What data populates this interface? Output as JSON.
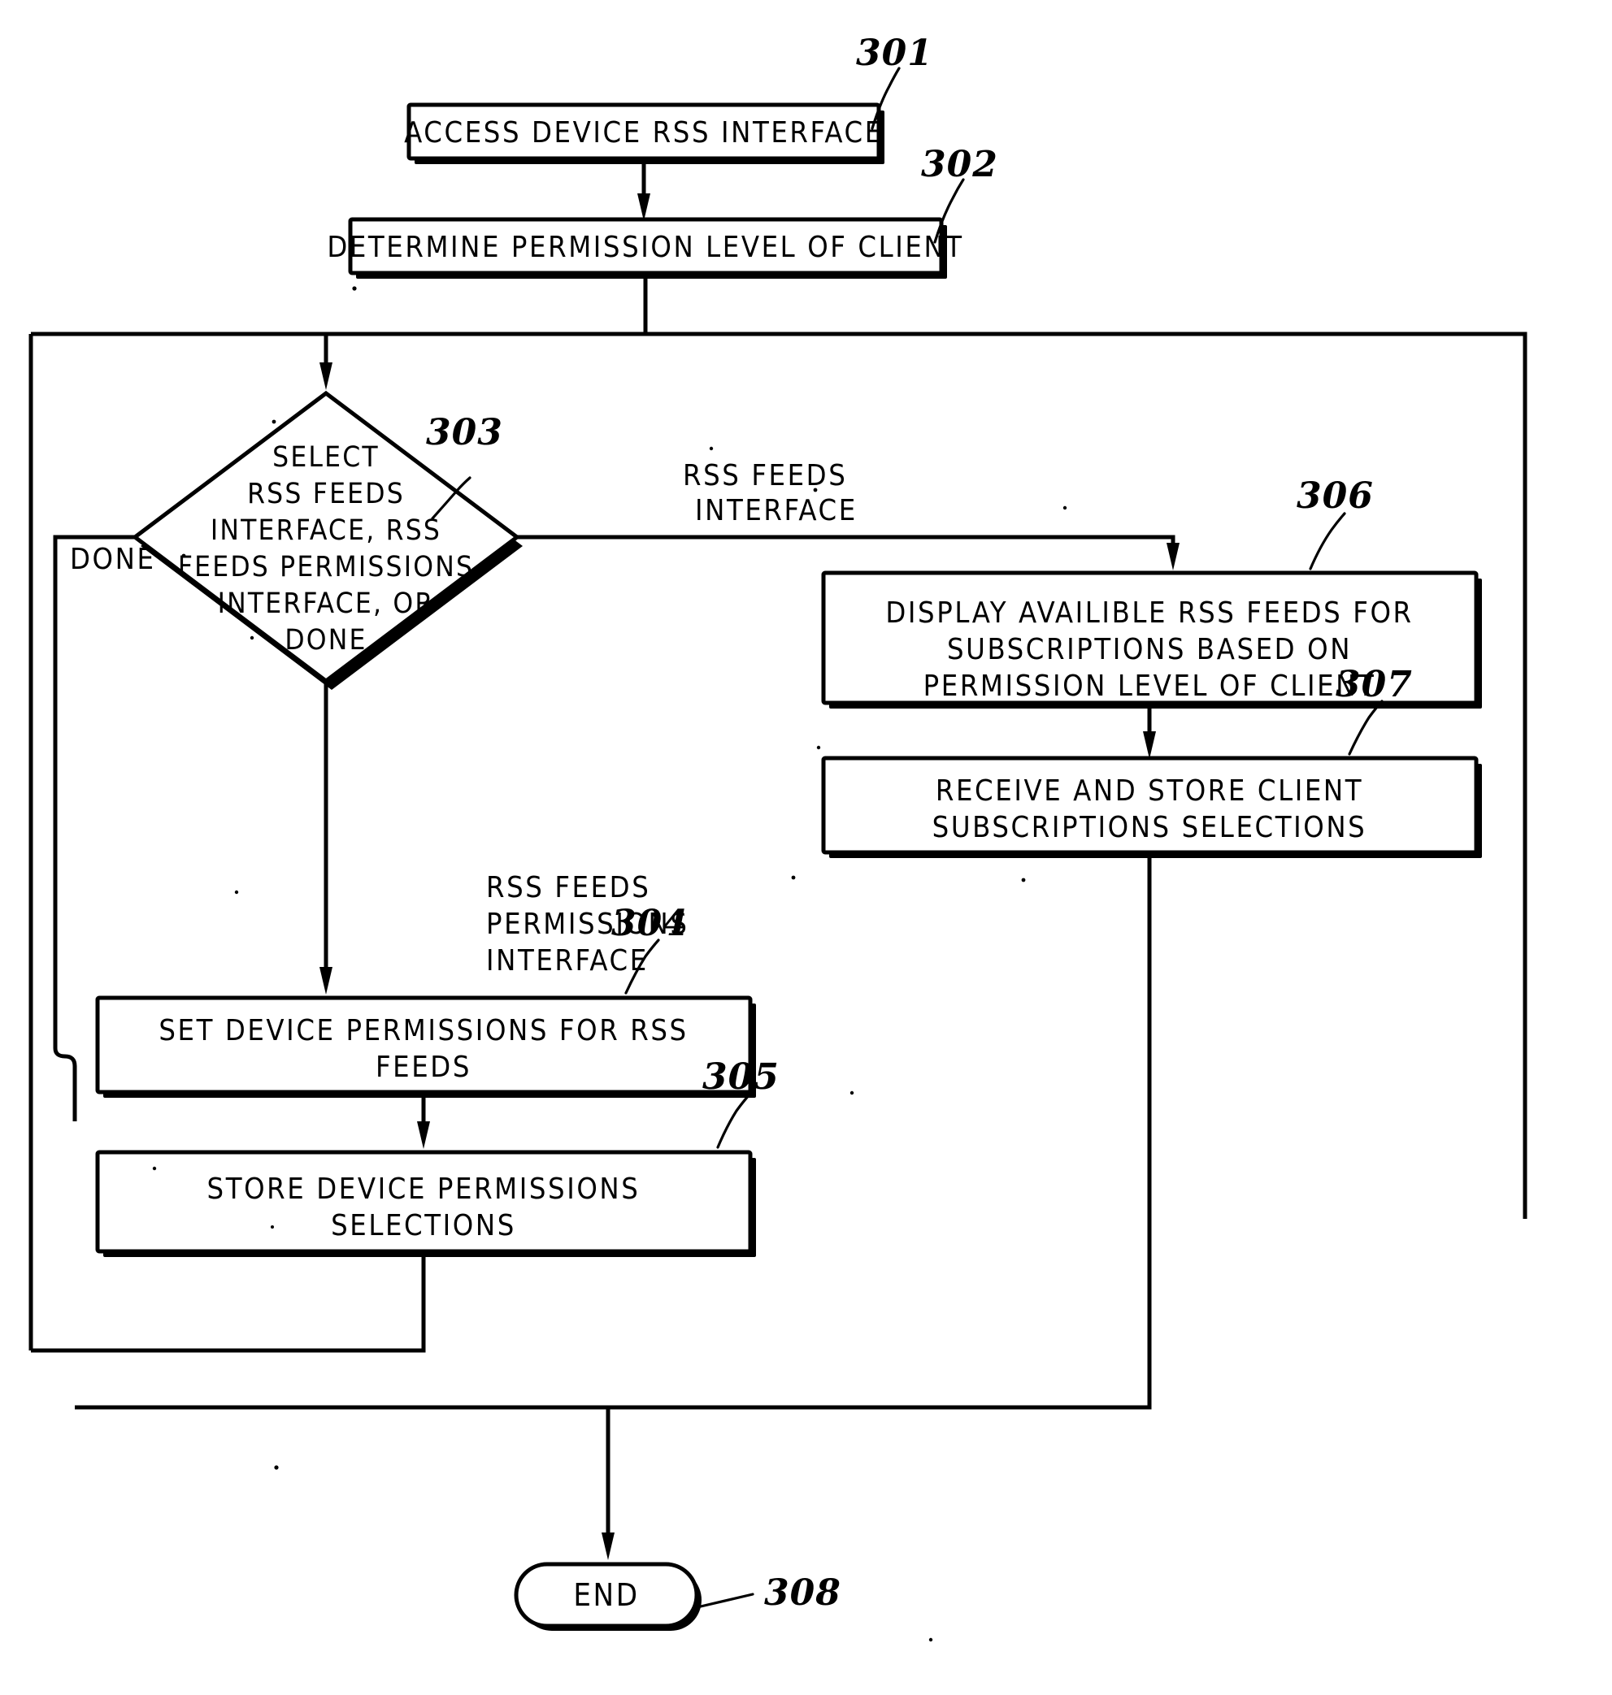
{
  "figure": {
    "kind": "patent-flowchart",
    "background_color": "#ffffff",
    "ink_color": "#000000",
    "nodes": [
      {
        "ref": "301",
        "shape": "process",
        "lines": [
          "ACCESS DEVICE RSS INTERFACE"
        ]
      },
      {
        "ref": "302",
        "shape": "process",
        "lines": [
          "DETERMINE PERMISSION LEVEL OF CLIENT"
        ]
      },
      {
        "ref": "303",
        "shape": "decision",
        "lines": [
          "SELECT",
          "RSS FEEDS",
          "INTERFACE, RSS",
          "FEEDS PERMISSIONS",
          "INTERFACE, OR",
          "DONE"
        ]
      },
      {
        "ref": "304",
        "shape": "process",
        "lines": [
          "SET DEVICE PERMISSIONS FOR RSS",
          "FEEDS"
        ]
      },
      {
        "ref": "305",
        "shape": "process",
        "lines": [
          "STORE DEVICE PERMISSIONS",
          "SELECTIONS"
        ]
      },
      {
        "ref": "306",
        "shape": "process",
        "lines": [
          "DISPLAY AVAILIBLE RSS FEEDS FOR",
          "SUBSCRIPTIONS BASED ON",
          "PERMISSION LEVEL OF CLIENT"
        ]
      },
      {
        "ref": "307",
        "shape": "process",
        "lines": [
          "RECEIVE AND STORE CLIENT",
          "SUBSCRIPTIONS SELECTIONS"
        ]
      },
      {
        "ref": "308",
        "shape": "terminator",
        "lines": [
          "END"
        ]
      }
    ],
    "edge_labels": [
      {
        "id": "done",
        "lines": [
          "DONE"
        ]
      },
      {
        "id": "rss-feeds-interface",
        "lines": [
          "RSS FEEDS",
          "INTERFACE"
        ]
      },
      {
        "id": "rss-feeds-permissions-interface",
        "lines": [
          "RSS FEEDS",
          "PERMISSIONS",
          "INTERFACE"
        ]
      }
    ],
    "ref_numbers": [
      "301",
      "302",
      "303",
      "304",
      "305",
      "306",
      "307",
      "308"
    ]
  }
}
